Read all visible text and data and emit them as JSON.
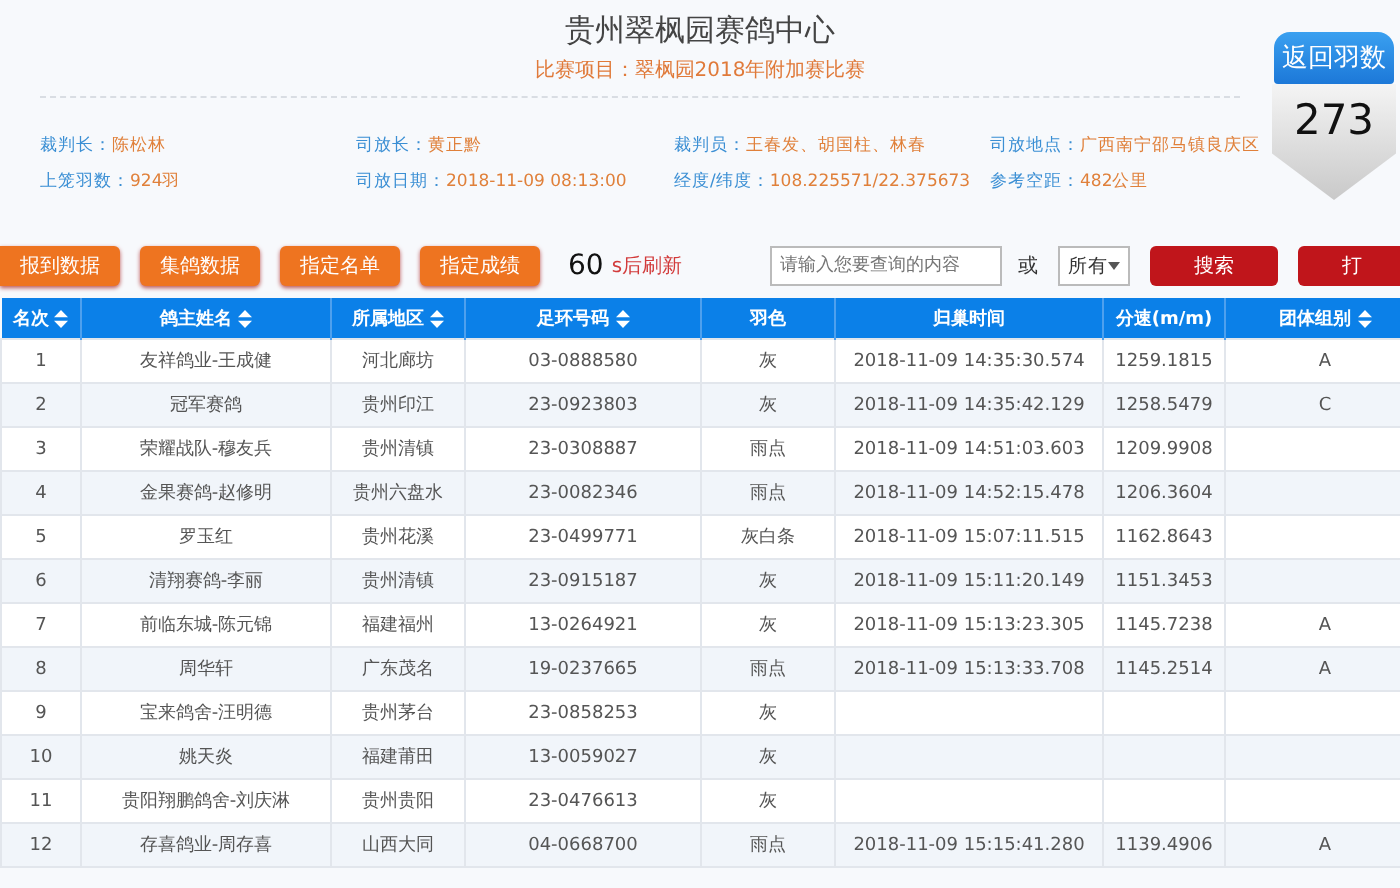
{
  "header": {
    "title": "贵州翠枫园赛鸽中心",
    "subtitle": "比赛项目：翠枫园2018年附加赛比赛"
  },
  "info": [
    {
      "label": "裁判长：",
      "value": "陈松林"
    },
    {
      "label": "司放长：",
      "value": "黄正黔"
    },
    {
      "label": "裁判员：",
      "value": "王春发、胡国柱、林春"
    },
    {
      "label": "司放地点：",
      "value": "广西南宁邵马镇良庆区"
    },
    {
      "label": "上笼羽数：",
      "value": "924羽"
    },
    {
      "label": "司放日期：",
      "value": "2018-11-09 08:13:00"
    },
    {
      "label": "经度/纬度：",
      "value": "108.225571/22.375673"
    },
    {
      "label": "参考空距：",
      "value": "482公里"
    }
  ],
  "badge": {
    "label": "返回羽数",
    "count": "273"
  },
  "toolbar": {
    "buttons": [
      "报到数据",
      "集鸽数据",
      "指定名单",
      "指定成绩"
    ],
    "countdown": "60",
    "countdown_label": "s后刷新",
    "search": {
      "placeholder": "请输入您要查询的内容"
    },
    "or_label": "或",
    "select": {
      "value": "所有"
    },
    "search_button": "搜索",
    "extra_button": "打"
  },
  "table": {
    "columns": [
      {
        "label": "名次",
        "sortable": true
      },
      {
        "label": "鸽主姓名",
        "sortable": true
      },
      {
        "label": "所属地区",
        "sortable": true
      },
      {
        "label": "足环号码",
        "sortable": true
      },
      {
        "label": "羽色",
        "sortable": false
      },
      {
        "label": "归巢时间",
        "sortable": false
      },
      {
        "label": "分速(m/m)",
        "sortable": false
      },
      {
        "label": "团体组别",
        "sortable": true
      }
    ],
    "rows": [
      {
        "rank": "1",
        "name": "友祥鸽业-王成健",
        "region": "河北廊坊",
        "ring": "03-0888580",
        "plumage": "灰",
        "time": "2018-11-09 14:35:30.574",
        "speed": "1259.1815",
        "group": "A"
      },
      {
        "rank": "2",
        "name": "冠军赛鸽",
        "region": "贵州印江",
        "ring": "23-0923803",
        "plumage": "灰",
        "time": "2018-11-09 14:35:42.129",
        "speed": "1258.5479",
        "group": "C"
      },
      {
        "rank": "3",
        "name": "荣耀战队-穆友兵",
        "region": "贵州清镇",
        "ring": "23-0308887",
        "plumage": "雨点",
        "time": "2018-11-09 14:51:03.603",
        "speed": "1209.9908"
      },
      {
        "rank": "4",
        "name": "金果赛鸽-赵修明",
        "region": "贵州六盘水",
        "ring": "23-0082346",
        "plumage": "雨点",
        "time": "2018-11-09 14:52:15.478",
        "speed": "1206.3604"
      },
      {
        "rank": "5",
        "name": "罗玉红",
        "region": "贵州花溪",
        "ring": "23-0499771",
        "plumage": "灰白条",
        "time": "2018-11-09 15:07:11.515",
        "speed": "1162.8643"
      },
      {
        "rank": "6",
        "name": "清翔赛鸽-李丽",
        "region": "贵州清镇",
        "ring": "23-0915187",
        "plumage": "灰",
        "time": "2018-11-09 15:11:20.149",
        "speed": "1151.3453"
      },
      {
        "rank": "7",
        "name": "前临东城-陈元锦",
        "region": "福建福州",
        "ring": "13-0264921",
        "plumage": "灰",
        "time": "2018-11-09 15:13:23.305",
        "speed": "1145.7238",
        "group": "A"
      },
      {
        "rank": "8",
        "name": "周华轩",
        "region": "广东茂名",
        "ring": "19-0237665",
        "plumage": "雨点",
        "time": "2018-11-09 15:13:33.708",
        "speed": "1145.2514",
        "group": "A"
      },
      {
        "rank": "9",
        "name": "宝来鸽舍-汪明德",
        "region": "贵州茅台",
        "ring": "23-0858253",
        "plumage": "灰"
      },
      {
        "rank": "10",
        "name": "姚天炎",
        "region": "福建莆田",
        "ring": "13-0059027",
        "plumage": "灰"
      },
      {
        "rank": "11",
        "name": "贵阳翔鹏鸽舍-刘庆淋",
        "region": "贵州贵阳",
        "ring": "23-0476613",
        "plumage": "灰"
      },
      {
        "rank": "12",
        "name": "存喜鸽业-周存喜",
        "region": "山西大同",
        "ring": "04-0668700",
        "plumage": "雨点",
        "time": "2018-11-09 15:15:41.280",
        "speed": "1139.4906",
        "group": "A"
      }
    ]
  }
}
